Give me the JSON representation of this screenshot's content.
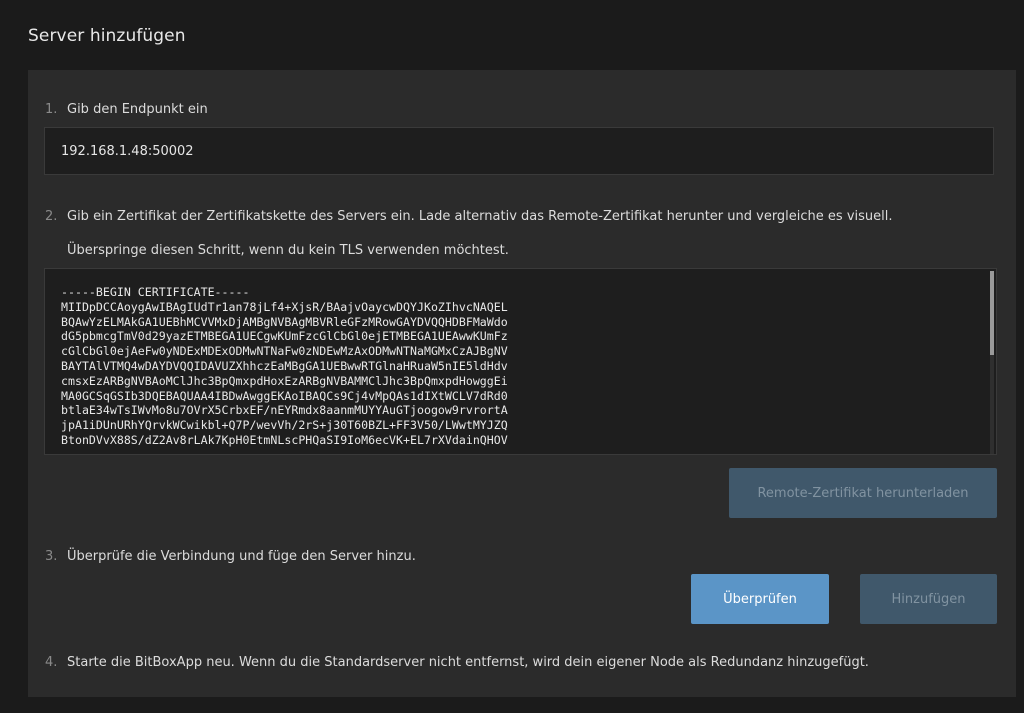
{
  "dialog": {
    "title": "Server hinzufügen"
  },
  "step1": {
    "number": "1.",
    "label": "Gib den Endpunkt ein",
    "endpoint_value": "192.168.1.48:50002"
  },
  "step2": {
    "number": "2.",
    "label": "Gib ein Zertifikat der Zertifikatskette des Servers ein. Lade alternativ das Remote-Zertifikat herunter und vergleiche es visuell.",
    "note": "Überspringe diesen Schritt, wenn du kein TLS verwenden möchtest.",
    "certificate": "-----BEGIN CERTIFICATE-----\nMIIDpDCCAoygAwIBAgIUdTr1an78jLf4+XjsR/BAajvOaycwDQYJKoZIhvcNAQEL\nBQAwYzELMAkGA1UEBhMCVVMxDjAMBgNVBAgMBVRleGFzMRowGAYDVQQHDBFMaWdo\ndG5pbmcgTmV0d29yazETMBEGA1UECgwKUmFzcGlCbGl0ejETMBEGA1UEAwwKUmFz\ncGlCbGl0ejAeFw0yNDExMDExODMwNTNaFw0zNDEwMzAxODMwNTNaMGMxCzAJBgNV\nBAYTAlVTMQ4wDAYDVQQIDAVUZXhhczEaMBgGA1UEBwwRTGlnaHRuaW5nIE5ldHdv\ncmsxEzARBgNVBAoMClJhc3BpQmxpdHoxEzARBgNVBAMMClJhc3BpQmxpdHowggEi\nMA0GCSqGSIb3DQEBAQUAA4IBDwAwggEKAoIBAQCs9Cj4vMpQAs1dIXtWCLV7dRd0\nbtlaE34wTsIWvMo8u7OVrX5CrbxEF/nEYRmdx8aanmMUYYAuGTjoogow9rvrortA\njpA1iDUnURhYQrvkWCwikbl+Q7P/wevVh/2rS+j30T60BZL+FF3V50/LWwtMYJZQ\nBtonDVvX88S/dZ2Av8rLAk7KpH0EtmNLscPHQaSI9IoM6ecVK+EL7rXVdainQHOV",
    "download_button": "Remote-Zertifikat herunterladen"
  },
  "step3": {
    "number": "3.",
    "label": "Überprüfe die Verbindung und füge den Server hinzu.",
    "check_button": "Überprüfen",
    "add_button": "Hinzufügen"
  },
  "step4": {
    "number": "4.",
    "label": "Starte die BitBoxApp neu. Wenn du die Standardserver nicht entfernst, wird dein eigener Node als Redundanz hinzugefügt."
  },
  "colors": {
    "background": "#1b1b1b",
    "panel": "#2b2b2b",
    "input": "#1e1e1e",
    "primary_button": "#5b95c7",
    "disabled_button": "#40586b"
  }
}
